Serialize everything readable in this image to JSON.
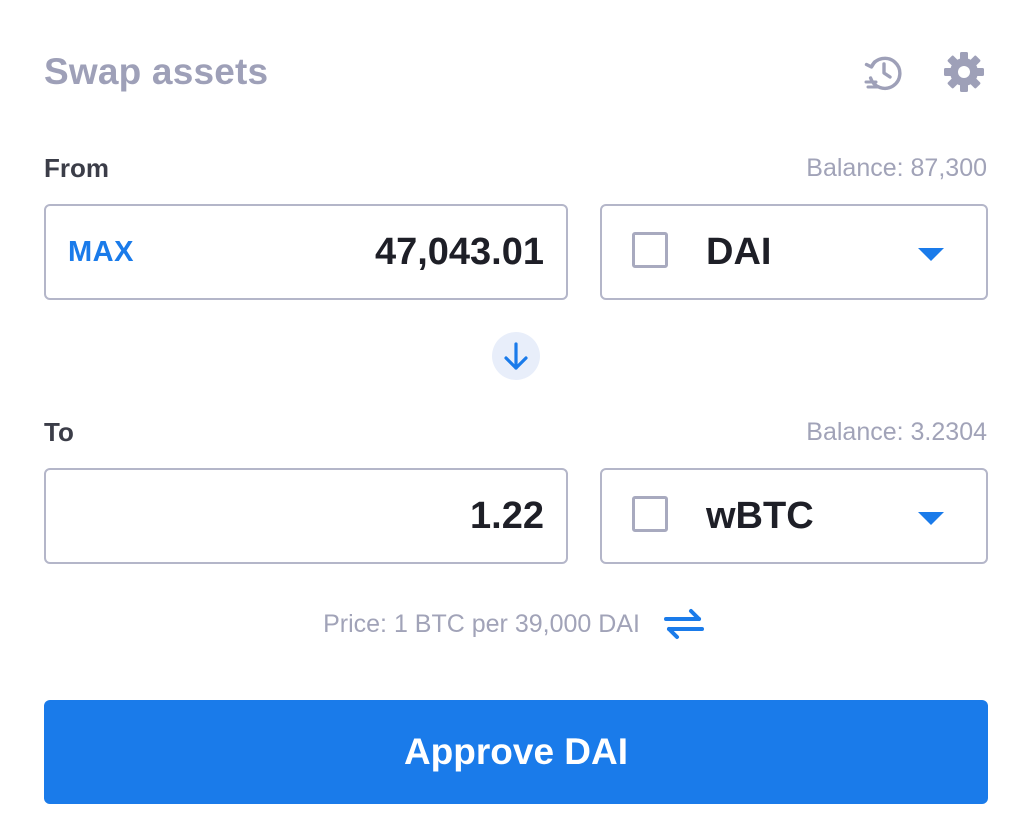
{
  "header": {
    "title": "Swap assets",
    "history_icon": "history-clock-icon",
    "settings_icon": "gear-icon"
  },
  "from": {
    "label": "From",
    "balance": "Balance: 87,300",
    "max_label": "MAX",
    "amount": "47,043.01",
    "token": {
      "symbol": "DAI",
      "icon": "token-placeholder-icon"
    }
  },
  "swap_direction": {
    "icon": "arrow-down-icon"
  },
  "to": {
    "label": "To",
    "balance": "Balance: 3.2304",
    "amount": "1.22",
    "token": {
      "symbol": "wBTC",
      "icon": "token-placeholder-icon"
    }
  },
  "price": {
    "text": "Price: 1 BTC per 39,000 DAI",
    "invert_icon": "swap-arrows-icon"
  },
  "approve_button": {
    "label": "Approve DAI"
  },
  "colors": {
    "accent": "#1a7bea",
    "title": "#9ea0b8",
    "muted_text": "#a1a3b8",
    "border": "#b4b6c9",
    "primary_text": "#1e1f27",
    "icon_bg": "#e8eefa"
  }
}
